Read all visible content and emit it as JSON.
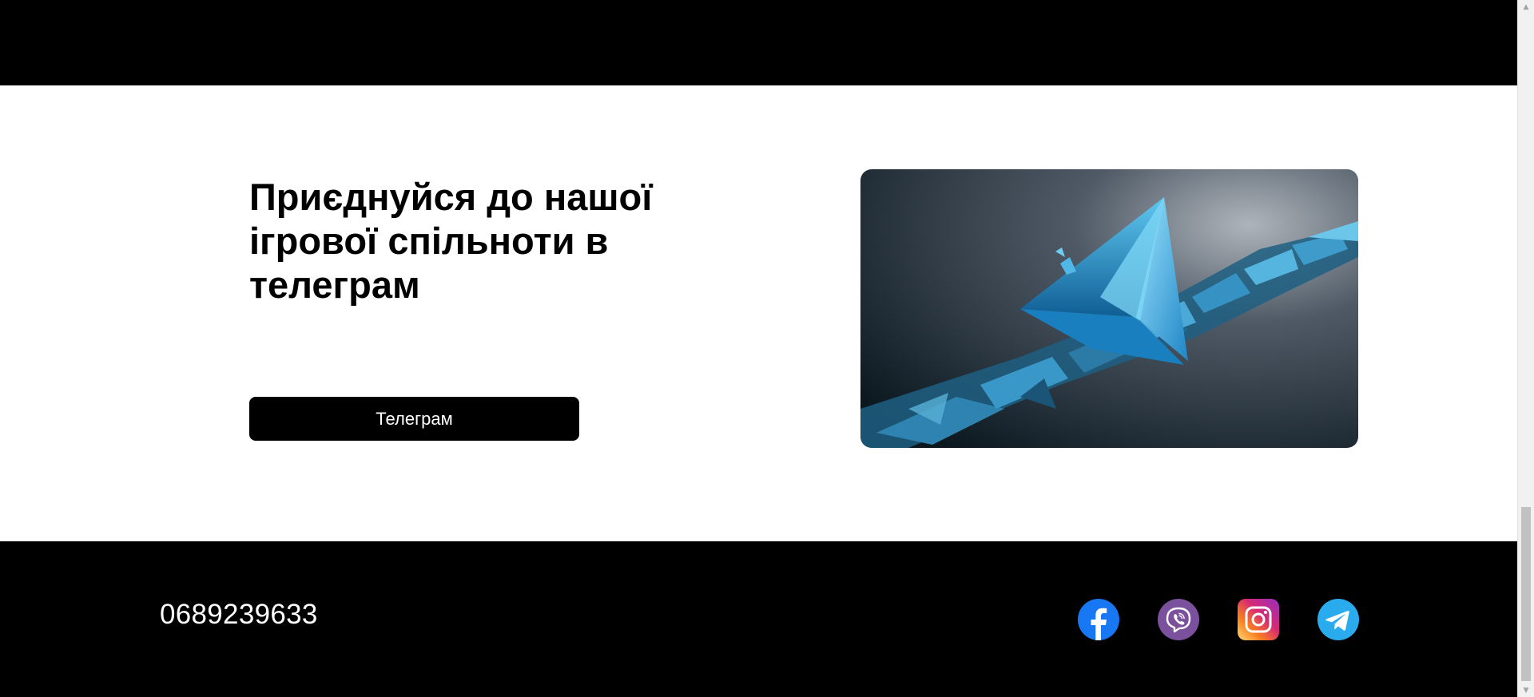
{
  "promo": {
    "title": "Приєднуйся до нашої ігрової спільноти в телеграм",
    "button_label": "Телеграм",
    "image_icon": "origami-paper-plane-illustration"
  },
  "footer": {
    "phone": "0689239633",
    "socials": [
      {
        "name": "facebook",
        "icon": "facebook-icon",
        "color": "#1877F2"
      },
      {
        "name": "viber",
        "icon": "viber-icon",
        "color": "#7B519D"
      },
      {
        "name": "instagram",
        "icon": "instagram-icon",
        "color": "#E1306C"
      },
      {
        "name": "telegram",
        "icon": "telegram-icon",
        "color": "#2AABEE"
      }
    ]
  },
  "colors": {
    "band": "#000000",
    "background": "#FFFFFF",
    "button": "#000000",
    "button_text": "#FFFFFF"
  },
  "scrollbar": {
    "up_icon": "scroll-up-arrow-icon",
    "down_icon": "scroll-down-arrow-icon"
  }
}
